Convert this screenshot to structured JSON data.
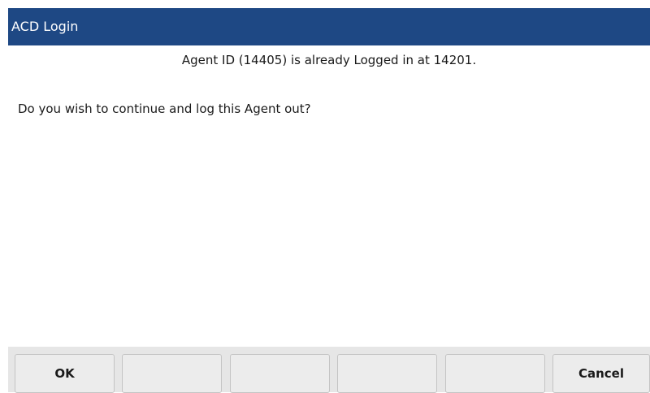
{
  "dialog": {
    "title": "ACD Login",
    "message": "Agent ID (14405) is already Logged in at 14201.",
    "prompt": "Do you wish to continue and log this Agent out?"
  },
  "softkeys": [
    {
      "label": "OK"
    },
    {
      "label": ""
    },
    {
      "label": ""
    },
    {
      "label": ""
    },
    {
      "label": ""
    },
    {
      "label": "Cancel"
    }
  ]
}
